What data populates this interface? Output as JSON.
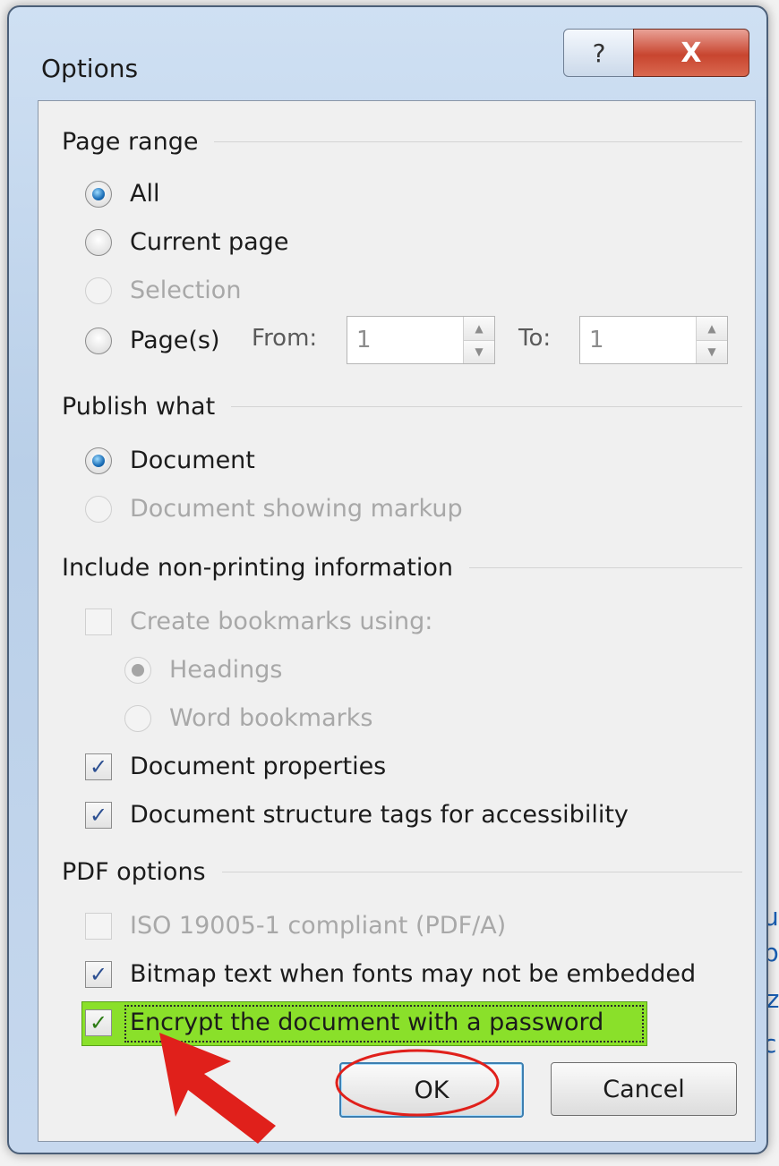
{
  "window": {
    "title": "Options",
    "help_glyph": "?",
    "close_glyph": "X"
  },
  "background": {
    "fragments": [
      "u",
      "p",
      "iz",
      "c"
    ]
  },
  "page_range": {
    "heading": "Page range",
    "options": [
      {
        "label": "All",
        "checked": true,
        "enabled": true
      },
      {
        "label": "Current page",
        "checked": false,
        "enabled": true
      },
      {
        "label": "Selection",
        "checked": false,
        "enabled": false
      },
      {
        "label": "Page(s)",
        "checked": false,
        "enabled": true
      }
    ],
    "from_label": "From:",
    "from_value": "1",
    "to_label": "To:",
    "to_value": "1"
  },
  "publish_what": {
    "heading": "Publish what",
    "options": [
      {
        "label": "Document",
        "checked": true,
        "enabled": true
      },
      {
        "label": "Document showing markup",
        "checked": false,
        "enabled": false
      }
    ]
  },
  "non_printing": {
    "heading": "Include non-printing information",
    "create_bookmarks": {
      "label": "Create bookmarks using:",
      "checked": false,
      "enabled": false
    },
    "bookmark_options": [
      {
        "label": "Headings",
        "checked": true,
        "enabled": false
      },
      {
        "label": "Word bookmarks",
        "checked": false,
        "enabled": false
      }
    ],
    "document_properties": {
      "label": "Document properties",
      "checked": true
    },
    "structure_tags": {
      "label": "Document structure tags for accessibility",
      "checked": true
    }
  },
  "pdf_options": {
    "heading": "PDF options",
    "iso": {
      "label": "ISO 19005-1 compliant (PDF/A)",
      "checked": false,
      "enabled": false
    },
    "bitmap_text": {
      "label": "Bitmap text when fonts may not be embedded",
      "checked": true
    },
    "encrypt": {
      "label": "Encrypt the document with a password",
      "checked": true
    }
  },
  "buttons": {
    "ok": "OK",
    "cancel": "Cancel"
  },
  "check_glyph": "✓",
  "colors": {
    "highlight": "#8ae02a",
    "annotation_red": "#e0201b",
    "close_red": "#c8452f"
  }
}
